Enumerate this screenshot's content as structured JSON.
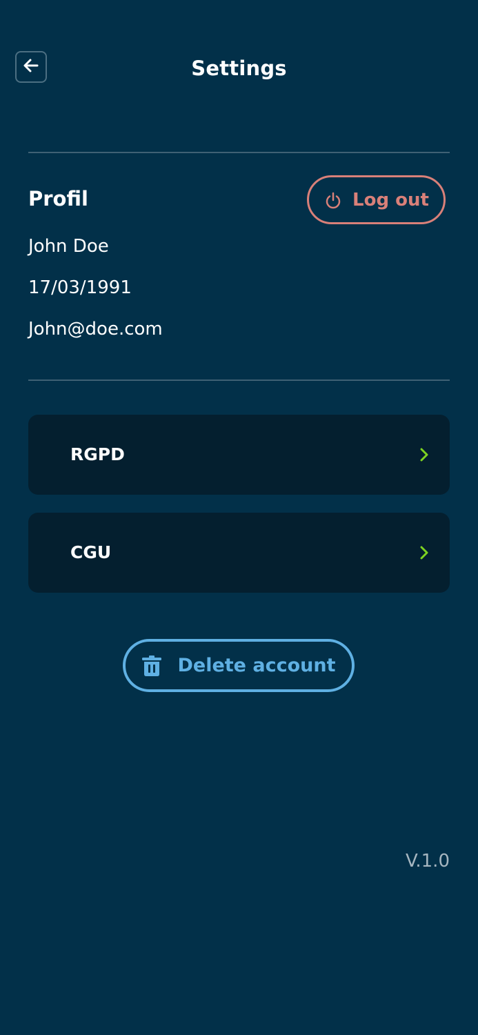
{
  "header": {
    "title": "Settings",
    "back_icon": "arrow-left-icon"
  },
  "profile": {
    "section_title": "Profil",
    "logout_label": "Log out",
    "logout_icon": "power-icon",
    "name": "John Doe",
    "birth_date": "17/03/1991",
    "email": "John@doe.com"
  },
  "menu": {
    "items": [
      {
        "label": "RGPD",
        "icon": "chevron-right-icon"
      },
      {
        "label": "CGU",
        "icon": "chevron-right-icon"
      }
    ]
  },
  "delete_account": {
    "label": "Delete account",
    "icon": "trash-icon"
  },
  "footer": {
    "version": "V.1.0"
  },
  "colors": {
    "background": "#023049",
    "card": "#041f2f",
    "logout_accent": "#d98079",
    "delete_accent": "#5fb0e3",
    "chevron_accent": "#7ed321",
    "divider": "#3f6174",
    "version_text": "#a6b6c0"
  }
}
